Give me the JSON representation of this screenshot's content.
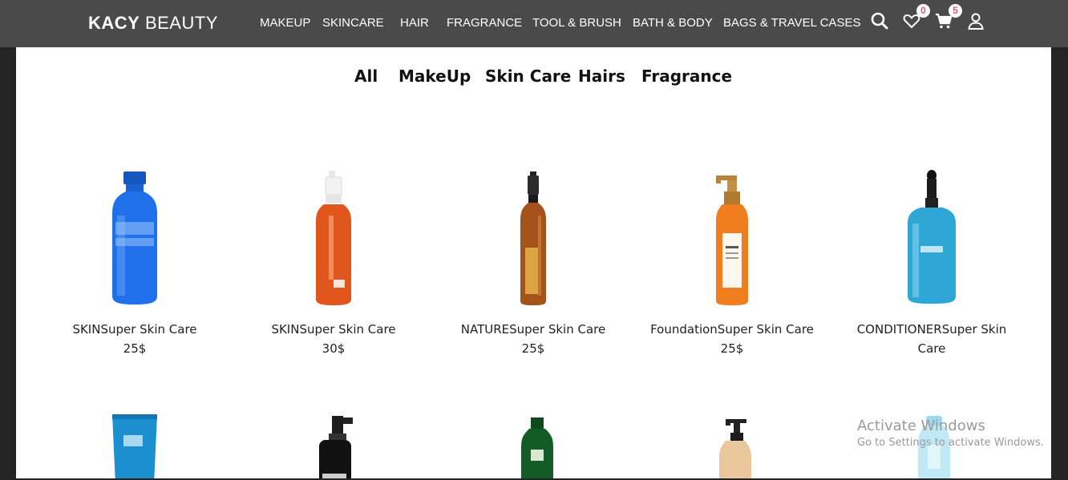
{
  "brand": {
    "bold": "KACY",
    "light": " BEAUTY"
  },
  "nav": {
    "items": [
      "MAKEUP",
      "SKINCARE",
      "HAIR",
      "FRAGRANCE",
      "TOOL & BRUSH",
      "BATH & BODY",
      "BAGS & TRAVEL CASES"
    ]
  },
  "header_icons": {
    "wishlist_count": "0",
    "cart_count": "5"
  },
  "filters": [
    "All",
    "MakeUp",
    "Skin Care",
    "Hairs",
    "Fragrance"
  ],
  "products": [
    {
      "name": "SKINSuper Skin Care",
      "price": "25$",
      "color": "#1f6fe0"
    },
    {
      "name": "SKINSuper Skin Care",
      "price": "30$",
      "color": "#e0561c"
    },
    {
      "name": "NATURESuper Skin Care",
      "price": "25$",
      "color": "#a4531b"
    },
    {
      "name": "FoundationSuper Skin Care",
      "price": "25$",
      "color": "#f07d1e"
    },
    {
      "name": "CONDITIONERSuper Skin Care",
      "price": "",
      "color": "#2ea6d6"
    }
  ],
  "watermark": {
    "line1": "Activate Windows",
    "line2": "Go to Settings to activate Windows."
  },
  "colors": {
    "topbar": "#4a4a4a",
    "badge_text": "#e0567b"
  }
}
